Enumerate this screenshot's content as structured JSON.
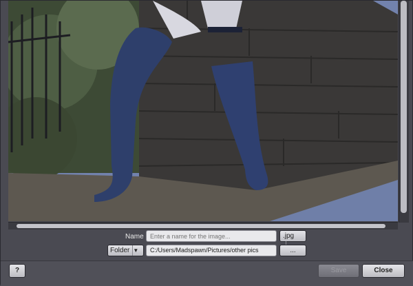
{
  "form": {
    "name_label": "Name :",
    "name_placeholder": "Enter a name for the image...",
    "format_value": ".jpg",
    "folder_label": "Folder",
    "path_value": "C:/Users/Madspawn/Pictures/other pics",
    "browse_label": "..."
  },
  "footer": {
    "help_label": "?",
    "save_label": "Save",
    "close_label": "Close"
  },
  "colors": {
    "sky": "#6f7fa8",
    "panel": "#4a4a52"
  }
}
